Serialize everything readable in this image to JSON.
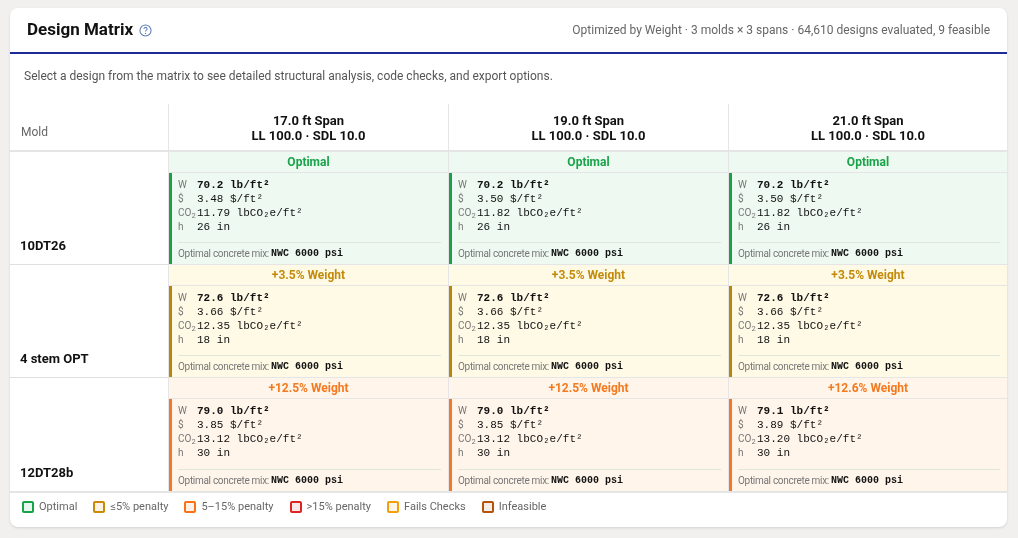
{
  "header": {
    "title": "Design Matrix",
    "summary": "Optimized by Weight · 3 molds × 3 spans · 64,610 designs evaluated, 9 feasible"
  },
  "description": "Select a design from the matrix to see detailed structural analysis, code checks, and export options.",
  "table": {
    "mold_heading": "Mold",
    "columns": [
      {
        "span": "17.0 ft Span",
        "loads": "LL 100.0 · SDL 10.0"
      },
      {
        "span": "19.0 ft Span",
        "loads": "LL 100.0 · SDL 10.0"
      },
      {
        "span": "21.0 ft Span",
        "loads": "LL 100.0 · SDL 10.0"
      }
    ],
    "rows": [
      {
        "mold": "10DT26",
        "cells": [
          {
            "kind": "optimal",
            "status": "Optimal",
            "metrics": [
              {
                "label": "W",
                "value": "70.2 lb/ft²"
              },
              {
                "label": "$",
                "value": "3.48 $/ft²"
              },
              {
                "label": "CO$_{2}$",
                "value": "11.79 lbCO₂e/ft²"
              },
              {
                "label": "h",
                "value": "26 in"
              }
            ],
            "mix_label": "Optimal concrete mix:",
            "mix": "NWC 6000 psi"
          },
          {
            "kind": "optimal",
            "status": "Optimal",
            "metrics": [
              {
                "label": "W",
                "value": "70.2 lb/ft²"
              },
              {
                "label": "$",
                "value": "3.50 $/ft²"
              },
              {
                "label": "CO$_{2}$",
                "value": "11.82 lbCO₂e/ft²"
              },
              {
                "label": "h",
                "value": "26 in"
              }
            ],
            "mix_label": "Optimal concrete mix:",
            "mix": "NWC 6000 psi"
          },
          {
            "kind": "optimal",
            "status": "Optimal",
            "metrics": [
              {
                "label": "W",
                "value": "70.2 lb/ft²"
              },
              {
                "label": "$",
                "value": "3.50 $/ft²"
              },
              {
                "label": "CO$_{2}$",
                "value": "11.82 lbCO₂e/ft²"
              },
              {
                "label": "h",
                "value": "26 in"
              }
            ],
            "mix_label": "Optimal concrete mix:",
            "mix": "NWC 6000 psi"
          }
        ]
      },
      {
        "mold": "4 stem OPT",
        "cells": [
          {
            "kind": "minor",
            "status": "+3.5% Weight",
            "metrics": [
              {
                "label": "W",
                "value": "72.6 lb/ft²"
              },
              {
                "label": "$",
                "value": "3.66 $/ft²"
              },
              {
                "label": "CO$_{2}$",
                "value": "12.35 lbCO₂e/ft²"
              },
              {
                "label": "h",
                "value": "18 in"
              }
            ],
            "mix_label": "Optimal concrete mix:",
            "mix": "NWC 6000 psi"
          },
          {
            "kind": "minor",
            "status": "+3.5% Weight",
            "metrics": [
              {
                "label": "W",
                "value": "72.6 lb/ft²"
              },
              {
                "label": "$",
                "value": "3.66 $/ft²"
              },
              {
                "label": "CO$_{2}$",
                "value": "12.35 lbCO₂e/ft²"
              },
              {
                "label": "h",
                "value": "18 in"
              }
            ],
            "mix_label": "Optimal concrete mix:",
            "mix": "NWC 6000 psi"
          },
          {
            "kind": "minor",
            "status": "+3.5% Weight",
            "metrics": [
              {
                "label": "W",
                "value": "72.6 lb/ft²"
              },
              {
                "label": "$",
                "value": "3.66 $/ft²"
              },
              {
                "label": "CO$_{2}$",
                "value": "12.35 lbCO₂e/ft²"
              },
              {
                "label": "h",
                "value": "18 in"
              }
            ],
            "mix_label": "Optimal concrete mix:",
            "mix": "NWC 6000 psi"
          }
        ]
      },
      {
        "mold": "12DT28b",
        "cells": [
          {
            "kind": "moderate",
            "status": "+12.5% Weight",
            "metrics": [
              {
                "label": "W",
                "value": "79.0 lb/ft²"
              },
              {
                "label": "$",
                "value": "3.85 $/ft²"
              },
              {
                "label": "CO$_{2}$",
                "value": "13.12 lbCO₂e/ft²"
              },
              {
                "label": "h",
                "value": "30 in"
              }
            ],
            "mix_label": "Optimal concrete mix:",
            "mix": "NWC 6000 psi"
          },
          {
            "kind": "moderate",
            "status": "+12.5% Weight",
            "metrics": [
              {
                "label": "W",
                "value": "79.0 lb/ft²"
              },
              {
                "label": "$",
                "value": "3.85 $/ft²"
              },
              {
                "label": "CO$_{2}$",
                "value": "13.12 lbCO₂e/ft²"
              },
              {
                "label": "h",
                "value": "30 in"
              }
            ],
            "mix_label": "Optimal concrete mix:",
            "mix": "NWC 6000 psi"
          },
          {
            "kind": "moderate",
            "status": "+12.6% Weight",
            "metrics": [
              {
                "label": "W",
                "value": "79.1 lb/ft²"
              },
              {
                "label": "$",
                "value": "3.89 $/ft²"
              },
              {
                "label": "CO$_{2}$",
                "value": "13.20 lbCO₂e/ft²"
              },
              {
                "label": "h",
                "value": "30 in"
              }
            ],
            "mix_label": "Optimal concrete mix:",
            "mix": "NWC 6000 psi"
          }
        ]
      }
    ]
  },
  "legend": [
    {
      "label": "Optimal",
      "color": "#16a34a"
    },
    {
      "label": "≤5% penalty",
      "color": "#ca8a04"
    },
    {
      "label": "5–15% penalty",
      "color": "#f97316"
    },
    {
      "label": ">15% penalty",
      "color": "#dc2626"
    },
    {
      "label": "Fails Checks",
      "color": "#f59e0b"
    },
    {
      "label": "Infeasible",
      "color": "#b45309"
    }
  ]
}
